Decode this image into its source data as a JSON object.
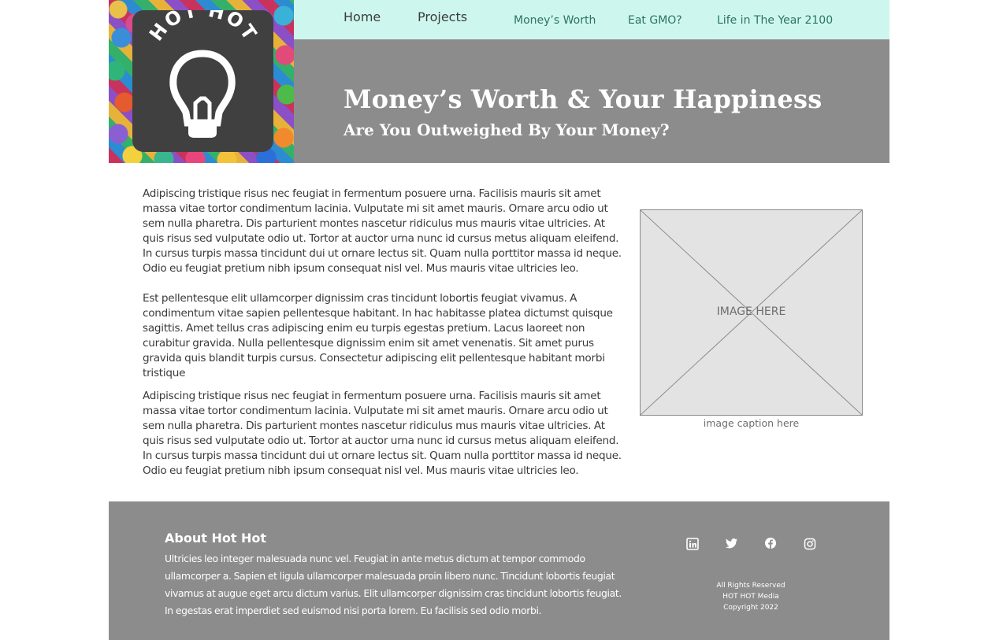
{
  "logo": {
    "text": "HOT HOT",
    "icon": "lightbulb-icon"
  },
  "nav": {
    "primary": [
      {
        "label": "Home"
      },
      {
        "label": "Projects"
      }
    ],
    "secondary": [
      {
        "label": "Money’s Worth"
      },
      {
        "label": "Eat GMO?"
      },
      {
        "label": "Life in The Year 2100"
      }
    ]
  },
  "hero": {
    "title": "Money’s Worth & Your Happiness",
    "subtitle": "Are You Outweighed By Your Money?"
  },
  "content": {
    "paragraphs": [
      "Adipiscing tristique risus nec feugiat in fermentum posuere urna. Facilisis mauris sit amet massa vitae tortor condimentum lacinia. Vulputate mi sit amet mauris. Ornare arcu odio ut sem nulla pharetra. Dis parturient montes nascetur ridiculus mus mauris vitae ultricies. At quis risus sed vulputate odio ut. Tortor at auctor urna nunc id cursus metus aliquam eleifend. In cursus turpis massa tincidunt dui ut ornare lectus sit. Quam nulla porttitor massa id neque. Odio eu feugiat pretium nibh ipsum consequat nisl vel. Mus mauris vitae ultricies leo.",
      "Est pellentesque elit ullamcorper dignissim cras tincidunt lobortis feugiat vivamus. A condimentum vitae sapien pellentesque habitant. In hac habitasse platea dictumst quisque sagittis. Amet tellus cras adipiscing enim eu turpis egestas pretium. Lacus laoreet non curabitur gravida. Nulla pellentesque dignissim enim sit amet venenatis. Sit amet purus gravida quis blandit turpis cursus. Consectetur adipiscing elit pellentesque habitant morbi tristique",
      "Adipiscing tristique risus nec feugiat in fermentum posuere urna. Facilisis mauris sit amet massa vitae tortor condimentum lacinia. Vulputate mi sit amet mauris. Ornare arcu odio ut sem nulla pharetra. Dis parturient montes nascetur ridiculus mus mauris vitae ultricies. At quis risus sed vulputate odio ut. Tortor at auctor urna nunc id cursus metus aliquam eleifend. In cursus turpis massa tincidunt dui ut ornare lectus sit. Quam nulla porttitor massa id neque. Odio eu feugiat pretium nibh ipsum consequat nisl vel. Mus mauris vitae ultricies leo."
    ]
  },
  "image": {
    "label": "IMAGE HERE",
    "caption": "image caption here"
  },
  "footer": {
    "heading": "About Hot Hot",
    "text": "Ultricies leo integer malesuada nunc vel. Feugiat in ante metus dictum at tempor commodo ullamcorper a. Sapien et ligula ullamcorper malesuada proin libero nunc. Tincidunt lobortis feugiat vivamus at augue eget arcu dictum varius. Elit ullamcorper dignissim cras tincidunt lobortis feugiat. In egestas erat imperdiet sed euismod nisi porta lorem. Eu facilisis sed odio morbi.",
    "social": [
      "linkedin-icon",
      "twitter-icon",
      "facebook-icon",
      "instagram-icon"
    ],
    "legal": {
      "rights": "All Rights Reserved",
      "company": "HOT HOT Media",
      "copyright": "Copyright 2022"
    }
  },
  "colors": {
    "nav_bg": "#cdf7ee",
    "nav_link": "#2e7360",
    "banner_bg": "#8c8c8c",
    "logo_card": "#414041",
    "footer_bg": "#8c8c8c"
  }
}
